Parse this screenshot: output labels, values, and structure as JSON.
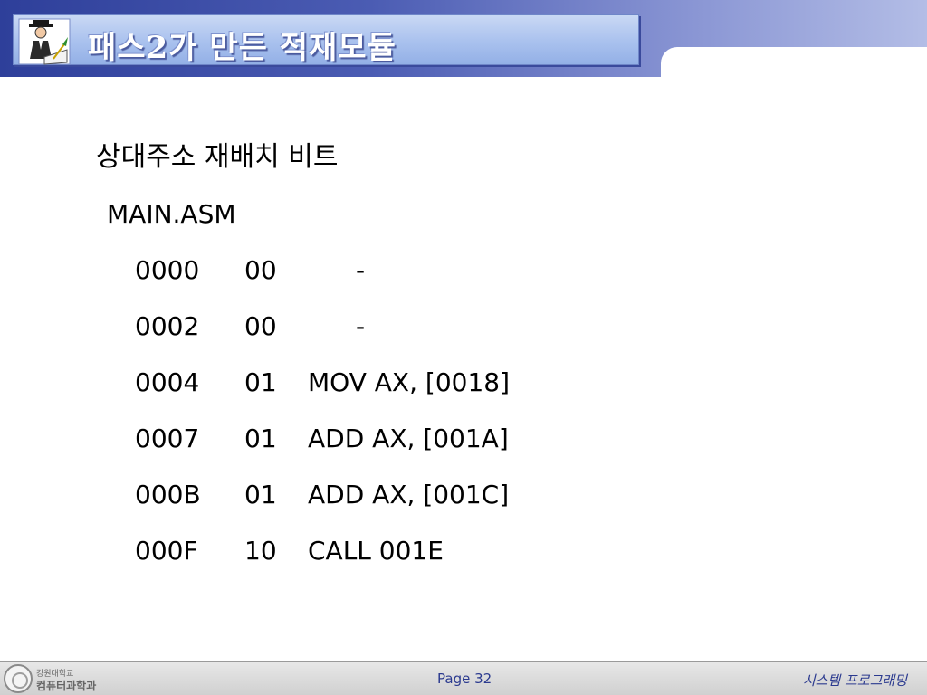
{
  "header": {
    "title": "패스2가 만든 적재모듈",
    "icon": "writer-at-desk-icon"
  },
  "content": {
    "heading": "상대주소  재배치 비트",
    "filename": "MAIN.ASM",
    "rows": [
      {
        "addr": "0000",
        "flag": "00",
        "instr": "-"
      },
      {
        "addr": "0002",
        "flag": "00",
        "instr": "-"
      },
      {
        "addr": "0004",
        "flag": "01",
        "instr": "MOV AX, [0018]"
      },
      {
        "addr": "0007",
        "flag": "01",
        "instr": "ADD AX, [001A]"
      },
      {
        "addr": "000B",
        "flag": "01",
        "instr": "ADD AX, [001C]"
      },
      {
        "addr": "000F",
        "flag": "10",
        "instr": "CALL 001E"
      }
    ]
  },
  "footer": {
    "logo_line1": "강원대학교",
    "logo_line2": "컴퓨터과학과",
    "page": "Page 32",
    "course": "시스템  프로그래밍"
  },
  "colors": {
    "header_dark": "#2e3f9a",
    "title_bar": "#a9c1ee",
    "footer_text": "#2b3a8f"
  }
}
